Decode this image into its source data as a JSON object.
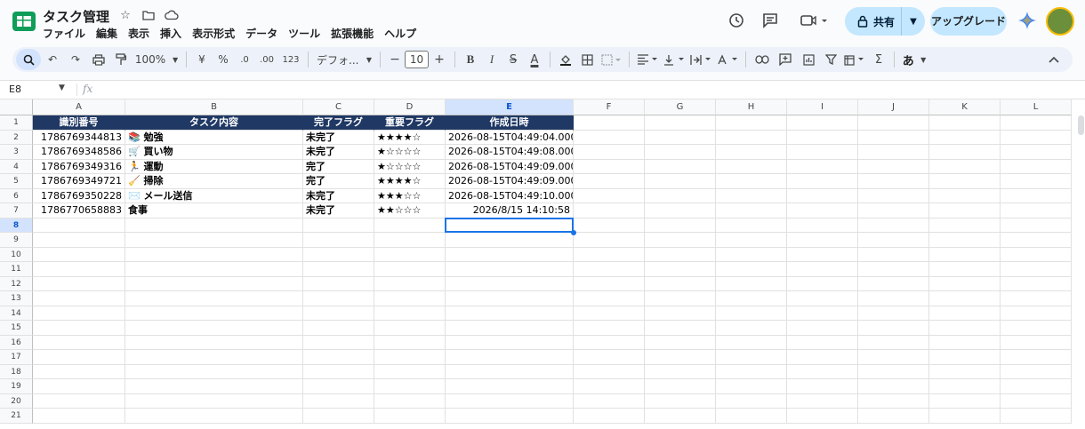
{
  "app": {
    "title": "タスク管理",
    "menu": [
      "ファイル",
      "編集",
      "表示",
      "挿入",
      "表示形式",
      "データ",
      "ツール",
      "拡張機能",
      "ヘルプ"
    ],
    "share_label": "共有",
    "upgrade_label": "アップグレード"
  },
  "toolbar": {
    "zoom": "100%",
    "currency": "¥",
    "percent": "%",
    "dec_decrease": ".0",
    "dec_increase": ".00",
    "number_format": "123",
    "font": "デフォ...",
    "font_size": "10",
    "bold": "B",
    "italic": "I",
    "strike": "S",
    "text_color": "A",
    "sum": "Σ",
    "input_mode": "あ"
  },
  "formula_bar": {
    "name_box": "E8",
    "fx": "fx",
    "value": ""
  },
  "sheet": {
    "columns": [
      "A",
      "B",
      "C",
      "D",
      "E",
      "F",
      "G",
      "H",
      "I",
      "J",
      "K",
      "L"
    ],
    "selected_column": "E",
    "rows": [
      "1",
      "2",
      "3",
      "4",
      "5",
      "6",
      "7",
      "8",
      "9",
      "10",
      "11",
      "12",
      "13",
      "14",
      "15",
      "16",
      "17",
      "18",
      "19",
      "20",
      "21"
    ],
    "selected_row": "8",
    "headers": [
      "識別番号",
      "タスク内容",
      "完了フラグ",
      "重要フラグ",
      "作成日時"
    ],
    "data": [
      {
        "id": "1786769344813",
        "task": "📚 勉強",
        "done": "未完了",
        "importance": "★★★★☆",
        "created": "2026-08-15T04:49:04.000Z"
      },
      {
        "id": "1786769348586",
        "task": "🛒 買い物",
        "done": "未完了",
        "importance": "★☆☆☆☆",
        "created": "2026-08-15T04:49:08.000Z"
      },
      {
        "id": "1786769349316",
        "task": "🏃 運動",
        "done": "完了",
        "importance": "★☆☆☆☆",
        "created": "2026-08-15T04:49:09.000Z"
      },
      {
        "id": "1786769349721",
        "task": "🧹 掃除",
        "done": "完了",
        "importance": "★★★★☆",
        "created": "2026-08-15T04:49:09.000Z"
      },
      {
        "id": "1786769350228",
        "task": "✉️ メール送信",
        "done": "未完了",
        "importance": "★★★☆☆",
        "created": "2026-08-15T04:49:10.000Z"
      },
      {
        "id": "1786770658883",
        "task": "食事",
        "done": "未完了",
        "importance": "★★☆☆☆",
        "created": "2026/8/15 14:10:58"
      }
    ],
    "header_color": "#1f3864",
    "selection_color": "#1a73e8"
  }
}
